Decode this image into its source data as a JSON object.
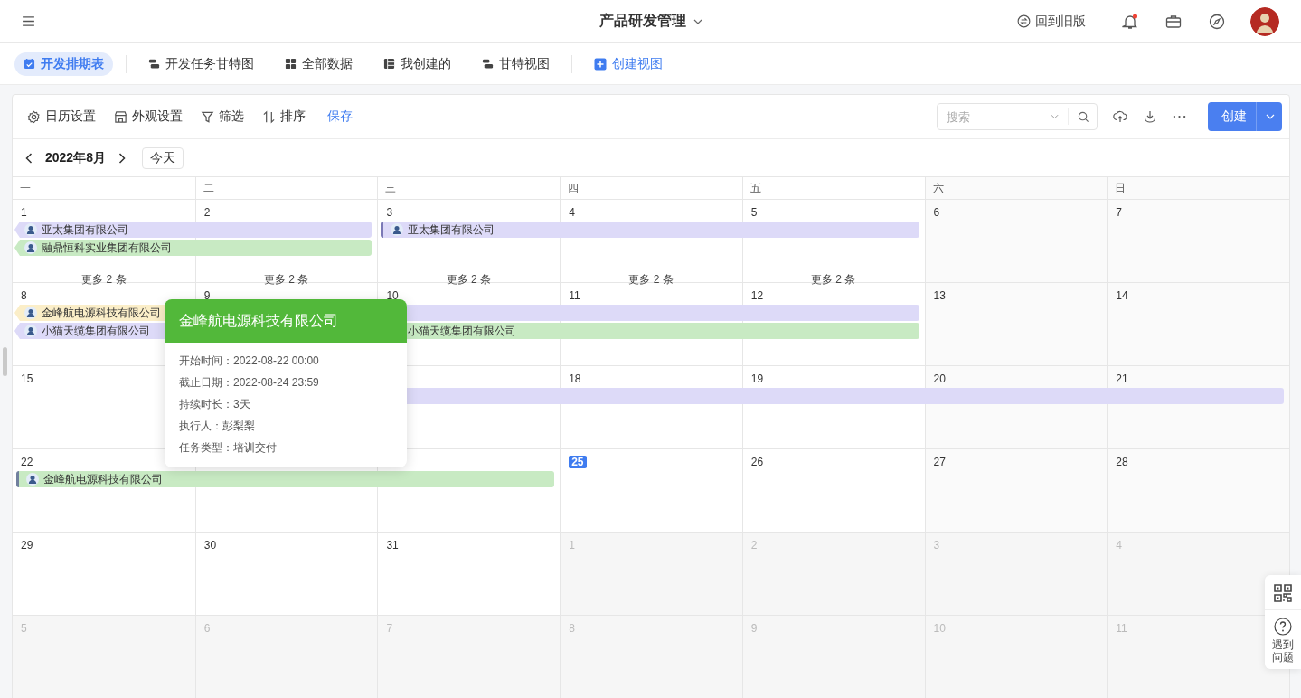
{
  "topbar": {
    "title": "产品研发管理",
    "old_version": "回到旧版",
    "has_notification": true
  },
  "views": [
    {
      "label": "开发排期表",
      "selected": true
    },
    {
      "label": "开发任务甘特图",
      "selected": false
    },
    {
      "label": "全部数据",
      "selected": false
    },
    {
      "label": "我创建的",
      "selected": false
    },
    {
      "label": "甘特视图",
      "selected": false
    }
  ],
  "create_view": "创建视图",
  "toolbar": {
    "items": [
      {
        "label": "日历设置"
      },
      {
        "label": "外观设置"
      },
      {
        "label": "筛选"
      },
      {
        "label": "排序"
      }
    ],
    "save": "保存",
    "search_placeholder": "搜索",
    "create": "创建"
  },
  "calendar": {
    "month": "2022年8月",
    "today_button": "今天",
    "weekdays": [
      "一",
      "二",
      "三",
      "四",
      "五",
      "六",
      "日"
    ],
    "weeks": [
      {
        "days": [
          {
            "label": "1",
            "kind": "day",
            "more": "更多 2 条"
          },
          {
            "label": "2",
            "kind": "day",
            "more": "更多 2 条"
          },
          {
            "label": "3",
            "kind": "day",
            "more": "更多 2 条"
          },
          {
            "label": "4",
            "kind": "day",
            "more": "更多 2 条"
          },
          {
            "label": "5",
            "kind": "day",
            "more": "更多 2 条"
          },
          {
            "label": "6",
            "kind": "day"
          },
          {
            "label": "7",
            "kind": "day"
          }
        ],
        "lanes": [
          [
            {
              "kind": "bar",
              "title": "亚太集团有限公司",
              "color": "#dddaf8",
              "continued": true
            },
            {
              "kind": "extend"
            },
            {
              "kind": "bar",
              "title": "亚太集团有限公司",
              "color": "#dddaf8",
              "continued": false
            },
            {
              "kind": "extend"
            },
            {
              "kind": "extend"
            },
            {
              "kind": "none"
            },
            {
              "kind": "none"
            }
          ],
          [
            {
              "kind": "bar",
              "title": "融鼎恒科实业集团有限公司",
              "color": "#c8eac3",
              "continued": true
            },
            {
              "kind": "extend"
            },
            {
              "kind": "none"
            },
            {
              "kind": "none"
            },
            {
              "kind": "none"
            },
            {
              "kind": "none"
            },
            {
              "kind": "none"
            }
          ]
        ]
      },
      {
        "days": [
          {
            "label": "8",
            "kind": "day"
          },
          {
            "label": "9",
            "kind": "day"
          },
          {
            "label": "10",
            "kind": "day"
          },
          {
            "label": "11",
            "kind": "day"
          },
          {
            "label": "12",
            "kind": "day"
          },
          {
            "label": "13",
            "kind": "day"
          },
          {
            "label": "14",
            "kind": "day"
          }
        ],
        "lanes": [
          [
            {
              "kind": "bar",
              "title": "金峰航电源科技有限公司",
              "color": "#fbeec8",
              "continued": true
            },
            {
              "kind": "bar",
              "color": "#dddaf8",
              "continued": false
            },
            {
              "kind": "extend"
            },
            {
              "kind": "extend"
            },
            {
              "kind": "extend"
            },
            {
              "kind": "none"
            },
            {
              "kind": "none"
            }
          ],
          [
            {
              "kind": "bar",
              "title": "小猫天缆集团有限公司",
              "color": "#dddaf8",
              "continued": true
            },
            {
              "kind": "none"
            },
            {
              "kind": "bar_plain",
              "title": "小猫天缆集团有限公司",
              "color": "#c8eac3",
              "continued": false
            },
            {
              "kind": "extend"
            },
            {
              "kind": "extend"
            },
            {
              "kind": "none"
            },
            {
              "kind": "none"
            }
          ]
        ]
      },
      {
        "days": [
          {
            "label": "15",
            "kind": "day"
          },
          {
            "kind": "hidden"
          },
          {
            "kind": "covered"
          },
          {
            "label": "18",
            "kind": "day"
          },
          {
            "label": "19",
            "kind": "day"
          },
          {
            "label": "20",
            "kind": "day"
          },
          {
            "label": "21",
            "kind": "day"
          }
        ],
        "lanes": [
          [
            {
              "kind": "none"
            },
            {
              "kind": "bar",
              "color": "#dddaf8",
              "continued": false
            },
            {
              "kind": "extend"
            },
            {
              "kind": "extend"
            },
            {
              "kind": "extend"
            },
            {
              "kind": "extend"
            },
            {
              "kind": "extend"
            }
          ]
        ]
      },
      {
        "days": [
          {
            "label": "22",
            "kind": "day"
          },
          {
            "kind": "covered"
          },
          {
            "kind": "covered"
          },
          {
            "label": "25",
            "kind": "today"
          },
          {
            "label": "26",
            "kind": "day"
          },
          {
            "label": "27",
            "kind": "day"
          },
          {
            "label": "28",
            "kind": "day"
          }
        ],
        "lanes": [
          [
            {
              "kind": "bar",
              "title": "金峰航电源科技有限公司",
              "color": "#c8eac3",
              "continued": false
            },
            {
              "kind": "extend"
            },
            {
              "kind": "extend"
            },
            {
              "kind": "none"
            },
            {
              "kind": "none"
            },
            {
              "kind": "none"
            },
            {
              "kind": "none"
            }
          ]
        ]
      },
      {
        "days": [
          {
            "label": "29",
            "kind": "day"
          },
          {
            "label": "30",
            "kind": "day"
          },
          {
            "label": "31",
            "kind": "day"
          },
          {
            "label": "1",
            "kind": "other_month"
          },
          {
            "label": "2",
            "kind": "other_month"
          },
          {
            "label": "3",
            "kind": "other_month"
          },
          {
            "label": "4",
            "kind": "other_month"
          }
        ]
      },
      {
        "days": [
          {
            "label": "5",
            "kind": "other_month"
          },
          {
            "label": "6",
            "kind": "other_month"
          },
          {
            "label": "7",
            "kind": "other_month"
          },
          {
            "label": "8",
            "kind": "other_month"
          },
          {
            "label": "9",
            "kind": "other_month"
          },
          {
            "label": "10",
            "kind": "other_month"
          },
          {
            "label": "11",
            "kind": "other_month"
          }
        ]
      }
    ]
  },
  "popup": {
    "title": "金峰航电源科技有限公司",
    "color": "#52b83a",
    "fields": [
      {
        "label": "开始时间：",
        "value": "2022-08-22 00:00"
      },
      {
        "label": "截止日期：",
        "value": "2022-08-24 23:59"
      },
      {
        "label": "持续时长：",
        "value": "3天"
      },
      {
        "label": "执行人：",
        "value": "彭梨梨"
      },
      {
        "label": "任务类型：",
        "value": "培训交付"
      }
    ]
  },
  "help": {
    "label": "遇到问题"
  }
}
